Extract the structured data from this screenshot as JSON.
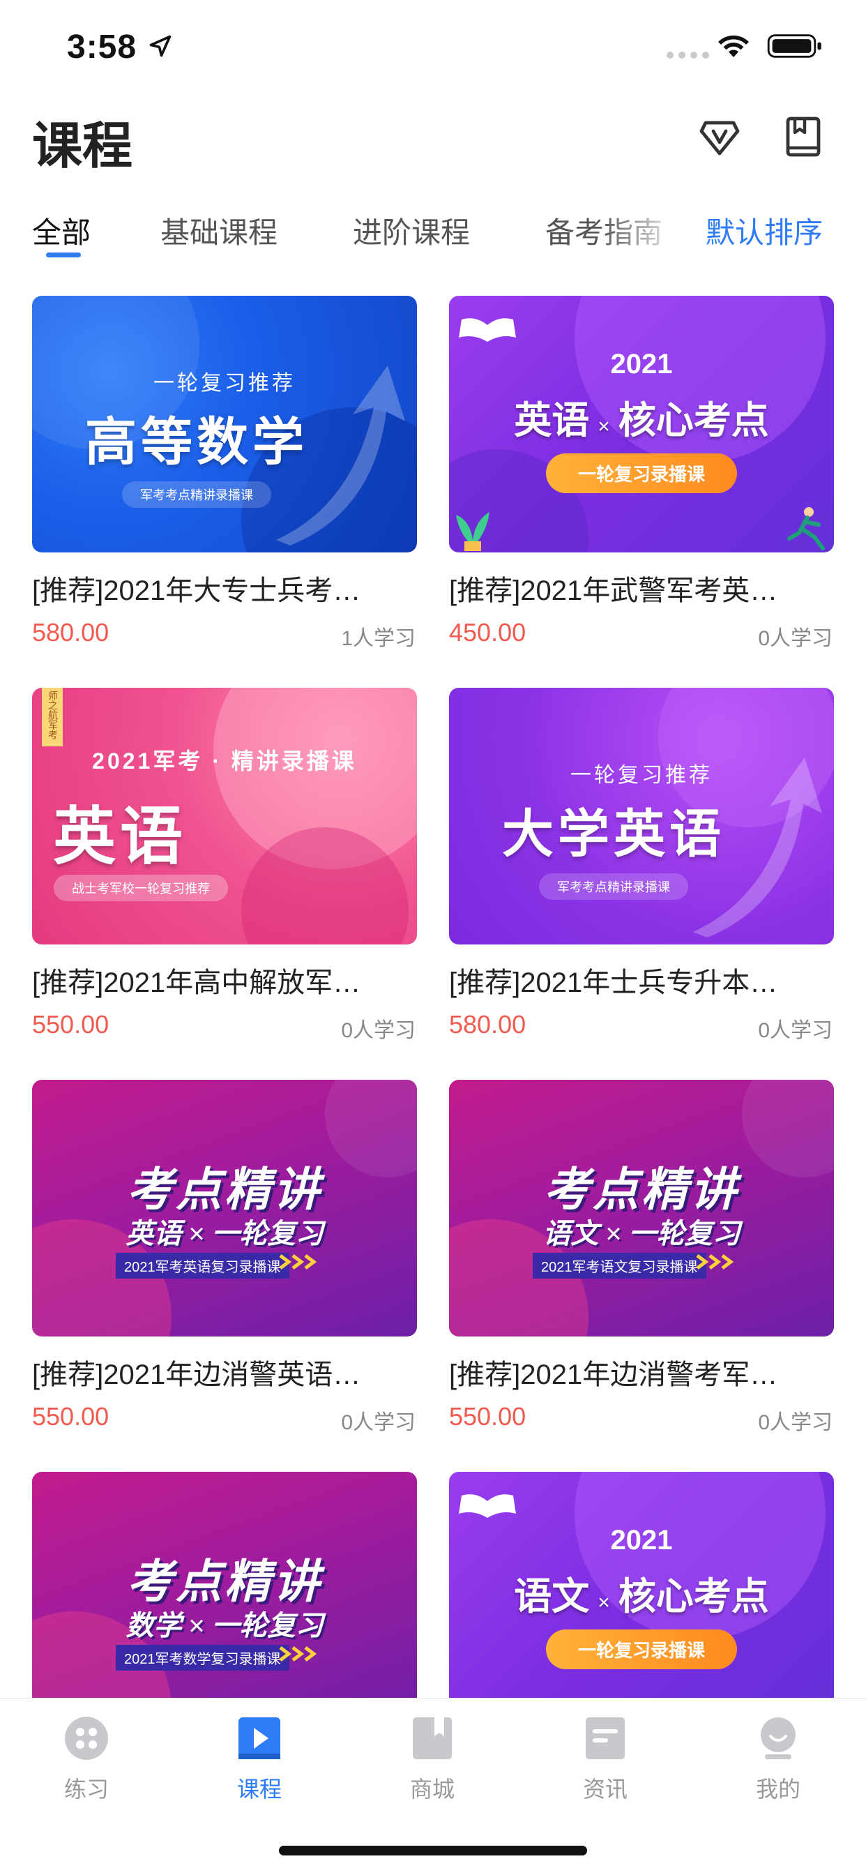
{
  "status_bar": {
    "time": "3:58"
  },
  "header": {
    "title": "课程"
  },
  "tabs": {
    "items": [
      {
        "label": "全部",
        "active": true
      },
      {
        "label": "基础课程",
        "active": false
      },
      {
        "label": "进阶课程",
        "active": false
      },
      {
        "label": "备考指南",
        "active": false
      }
    ],
    "sort_label": "默认排序"
  },
  "courses": [
    {
      "title": "[推荐]2021年大专士兵考…",
      "price": "580.00",
      "learners": "1人学习",
      "thumb": {
        "small": "一轮复习推荐",
        "big": "高等数学",
        "pill": "军考考点精讲录播课"
      }
    },
    {
      "title": "[推荐]2021年武警军考英…",
      "price": "450.00",
      "learners": "0人学习",
      "thumb": {
        "year": "2021",
        "subject": "英语",
        "x": "×",
        "topic": "核心考点",
        "pill": "一轮复习录播课"
      }
    },
    {
      "title": "[推荐]2021年高中解放军…",
      "price": "550.00",
      "learners": "0人学习",
      "thumb": {
        "ribbon": "师之航军考",
        "small": "2021军考 · 精讲录播课",
        "big": "英语",
        "pill": "战士考军校一轮复习推荐"
      }
    },
    {
      "title": "[推荐]2021年士兵专升本…",
      "price": "580.00",
      "learners": "0人学习",
      "thumb": {
        "small": "一轮复习推荐",
        "big": "大学英语",
        "pill": "军考考点精讲录播课"
      }
    },
    {
      "title": "[推荐]2021年边消警英语…",
      "price": "550.00",
      "learners": "0人学习",
      "thumb": {
        "big": "考点精讲",
        "subject": "英语",
        "x": "×",
        "sub": "一轮复习",
        "tag": "2021军考英语复习录播课"
      }
    },
    {
      "title": "[推荐]2021年边消警考军…",
      "price": "550.00",
      "learners": "0人学习",
      "thumb": {
        "big": "考点精讲",
        "subject": "语文",
        "x": "×",
        "sub": "一轮复习",
        "tag": "2021军考语文复习录播课"
      }
    },
    {
      "thumb": {
        "big": "考点精讲",
        "subject": "数学",
        "x": "×",
        "sub": "一轮复习",
        "tag": "2021军考数学复习录播课"
      }
    },
    {
      "thumb": {
        "year": "2021",
        "subject": "语文",
        "x": "×",
        "topic": "核心考点",
        "pill": "一轮复习录播课"
      }
    }
  ],
  "tabbar": [
    {
      "label": "练习",
      "icon": "practice-icon",
      "active": false
    },
    {
      "label": "课程",
      "icon": "course-play-icon",
      "active": true
    },
    {
      "label": "商城",
      "icon": "shop-bookmark-icon",
      "active": false
    },
    {
      "label": "资讯",
      "icon": "news-icon",
      "active": false
    },
    {
      "label": "我的",
      "icon": "profile-icon",
      "active": false
    }
  ],
  "colors": {
    "accent": "#2e7cf6",
    "price": "#f25a4f",
    "inactive": "#999999"
  }
}
